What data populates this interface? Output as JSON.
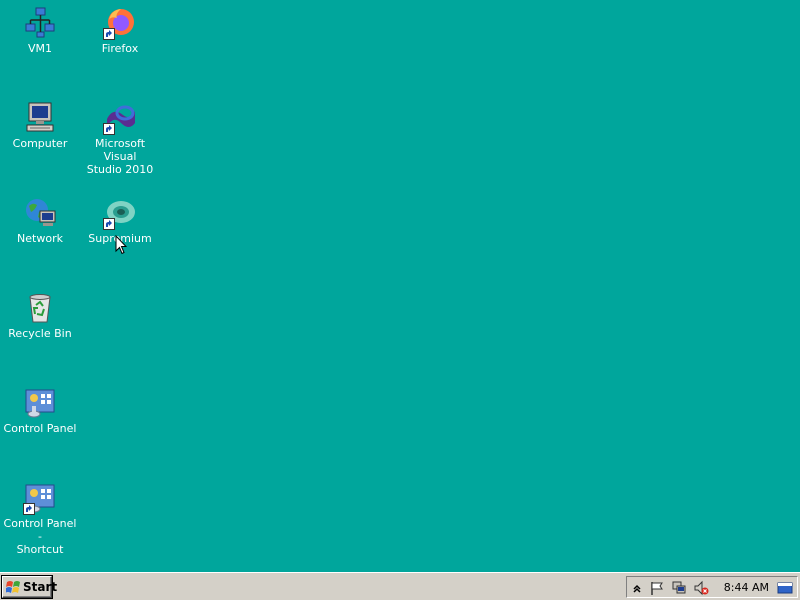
{
  "desktop": {
    "background_color": "#00A69C",
    "icons": {
      "vm1": {
        "label": "VM1",
        "icon": "network-share-icon"
      },
      "firefox": {
        "label": "Firefox",
        "icon": "firefox-icon"
      },
      "computer": {
        "label": "Computer",
        "icon": "computer-icon"
      },
      "visual_studio": {
        "label": "Microsoft Visual\nStudio 2010",
        "icon": "visual-studio-icon"
      },
      "network": {
        "label": "Network",
        "icon": "network-icon"
      },
      "supremium": {
        "label": "Supremium",
        "icon": "supremium-icon"
      },
      "recycle_bin": {
        "label": "Recycle Bin",
        "icon": "recycle-bin-icon"
      },
      "control_panel": {
        "label": "Control Panel",
        "icon": "control-panel-icon"
      },
      "control_panel_shortcut": {
        "label": "Control Panel -\nShortcut",
        "icon": "control-panel-icon"
      }
    }
  },
  "taskbar": {
    "start_label": "Start",
    "clock": "8:44 AM",
    "tray_icons": [
      "chevron-up-icon",
      "flag-icon",
      "network-tray-icon",
      "speaker-muted-icon",
      "show-desktop-icon"
    ]
  }
}
